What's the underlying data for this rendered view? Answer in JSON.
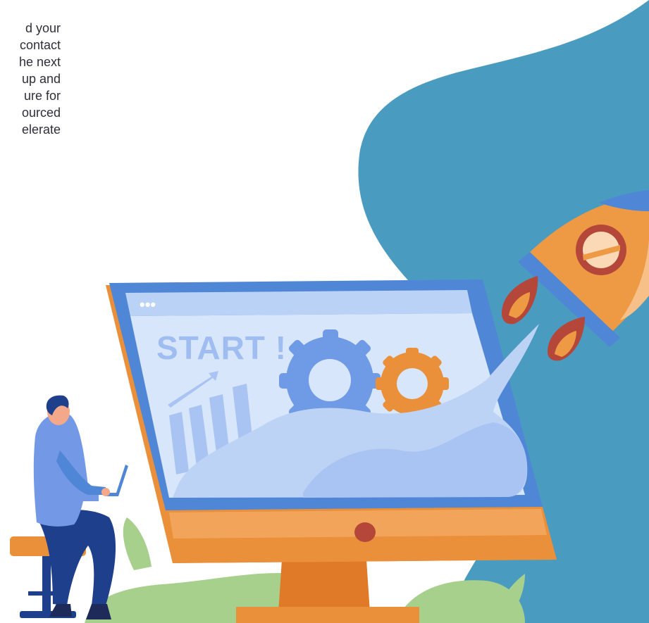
{
  "intro": {
    "lines": [
      "d your",
      "contact",
      "he next",
      "up and",
      "ure for",
      "ourced",
      "elerate"
    ]
  },
  "illustration": {
    "screen_label": "START !",
    "window_dots": "•••",
    "colors": {
      "blob": "#4a9bc0",
      "monitor_frame": "#4f86d6",
      "monitor_screen": "#d7e6fb",
      "monitor_base": "#ea8f3a",
      "rocket_body": "#ee9a45",
      "rocket_flame": "#b5463a",
      "plant": "#a8d08d",
      "person_shirt": "#7398e6",
      "person_pants": "#1e3f8c",
      "stool": "#ea8f3a"
    },
    "icons": [
      "rocket-icon",
      "gear-icon",
      "bar-chart-icon",
      "monitor-icon",
      "person-figure",
      "plant-icon"
    ]
  }
}
